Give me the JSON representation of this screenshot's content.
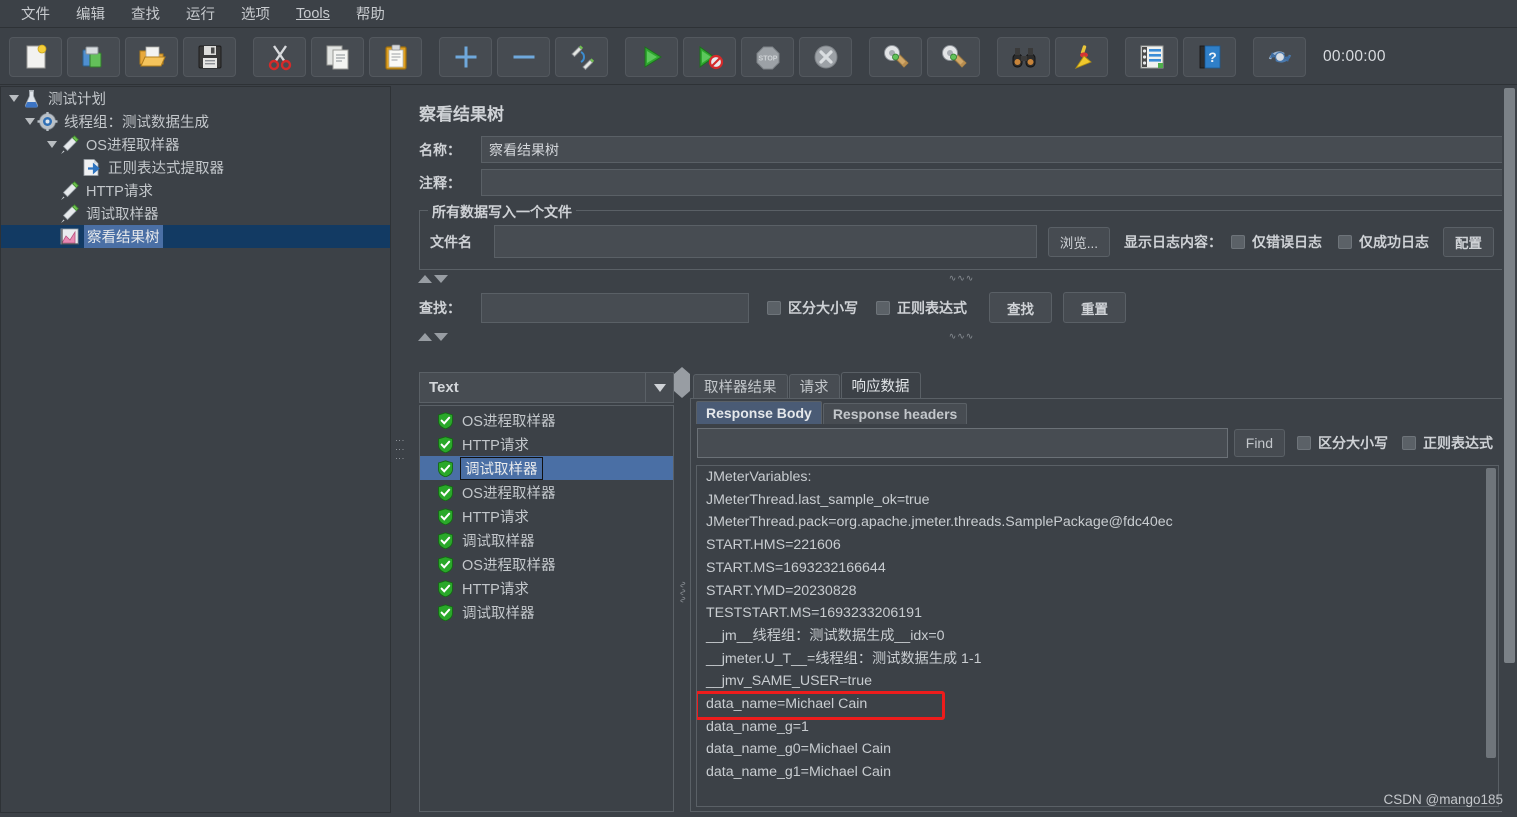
{
  "menubar": {
    "items": [
      {
        "label": "文件",
        "name": "menu-file"
      },
      {
        "label": "编辑",
        "name": "menu-edit"
      },
      {
        "label": "查找",
        "name": "menu-search"
      },
      {
        "label": "运行",
        "name": "menu-run"
      },
      {
        "label": "选项",
        "name": "menu-options"
      },
      {
        "label": "Tools",
        "name": "menu-tools",
        "mnemonic": "T"
      },
      {
        "label": "帮助",
        "name": "menu-help"
      }
    ]
  },
  "toolbar": {
    "buttons": [
      {
        "icon": "new-file-icon"
      },
      {
        "icon": "templates-icon"
      },
      {
        "icon": "open-folder-icon"
      },
      {
        "icon": "save-icon"
      },
      {
        "icon": "cut-icon"
      },
      {
        "icon": "copy-icon"
      },
      {
        "icon": "paste-icon"
      },
      {
        "icon": "expand-all-icon"
      },
      {
        "icon": "collapse-all-icon"
      },
      {
        "icon": "toggle-icon"
      },
      {
        "icon": "start-icon"
      },
      {
        "icon": "start-no-pauses-icon"
      },
      {
        "icon": "stop-icon"
      },
      {
        "icon": "shutdown-icon"
      },
      {
        "icon": "clear-icon"
      },
      {
        "icon": "clear-all-icon"
      },
      {
        "icon": "search-binoculars-icon"
      },
      {
        "icon": "search-reset-broom-icon"
      },
      {
        "icon": "function-helper-icon"
      },
      {
        "icon": "help-book-icon"
      },
      {
        "icon": "undo-redo-icon"
      }
    ],
    "timer": "00:00:00"
  },
  "tree": {
    "nodes": [
      {
        "label": "测试计划",
        "depth": 0,
        "icon": "test-plan-icon",
        "twisty": true,
        "selected": false
      },
      {
        "label": "线程组：测试数据生成",
        "depth": 1,
        "icon": "thread-group-icon",
        "twisty": true,
        "selected": false
      },
      {
        "label": "OS进程取样器",
        "depth": 2,
        "icon": "sampler-icon",
        "twisty": true,
        "selected": false
      },
      {
        "label": "正则表达式提取器",
        "depth": 3,
        "icon": "post-processor-icon",
        "twisty": false,
        "selected": false
      },
      {
        "label": "HTTP请求",
        "depth": 2,
        "icon": "sampler-icon",
        "twisty": false,
        "selected": false
      },
      {
        "label": "调试取样器",
        "depth": 2,
        "icon": "sampler-icon",
        "twisty": false,
        "selected": false
      },
      {
        "label": "察看结果树",
        "depth": 2,
        "icon": "view-results-tree-icon",
        "twisty": false,
        "selected": true
      }
    ]
  },
  "panel": {
    "title": "察看结果树",
    "name_label": "名称：",
    "name_value": "察看结果树",
    "comment_label": "注释：",
    "comment_value": "",
    "filegroup": {
      "legend": "所有数据写入一个文件",
      "filename_label": "文件名",
      "filename_value": "",
      "browse_button": "浏览...",
      "log_display_label": "显示日志内容：",
      "errors_only_label": "仅错误日志",
      "errors_only_checked": false,
      "success_only_label": "仅成功日志",
      "success_only_checked": false,
      "configure_button": "配置"
    },
    "search": {
      "label": "查找：",
      "value": "",
      "case_label": "区分大小写",
      "case_checked": false,
      "regex_label": "正则表达式",
      "regex_checked": false,
      "search_button": "查找",
      "reset_button": "重置"
    }
  },
  "results": {
    "renderer_selected": "Text",
    "items": [
      {
        "label": "OS进程取样器",
        "status": "success",
        "selected": false
      },
      {
        "label": "HTTP请求",
        "status": "success",
        "selected": false
      },
      {
        "label": "调试取样器",
        "status": "success",
        "selected": true
      },
      {
        "label": "OS进程取样器",
        "status": "success",
        "selected": false
      },
      {
        "label": "HTTP请求",
        "status": "success",
        "selected": false
      },
      {
        "label": "调试取样器",
        "status": "success",
        "selected": false
      },
      {
        "label": "OS进程取样器",
        "status": "success",
        "selected": false
      },
      {
        "label": "HTTP请求",
        "status": "success",
        "selected": false
      },
      {
        "label": "调试取样器",
        "status": "success",
        "selected": false
      }
    ]
  },
  "detail": {
    "tabs": [
      {
        "label": "取样器结果",
        "active": false
      },
      {
        "label": "请求",
        "active": false
      },
      {
        "label": "响应数据",
        "active": true
      }
    ],
    "subtabs": [
      {
        "label": "Response Body",
        "active": true
      },
      {
        "label": "Response headers",
        "active": false
      }
    ],
    "find": {
      "value": "",
      "find_button": "Find",
      "case_label": "区分大小写",
      "case_checked": false,
      "regex_label": "正则表达式",
      "regex_checked": false
    },
    "body_lines": [
      "JMeterVariables:",
      "JMeterThread.last_sample_ok=true",
      "JMeterThread.pack=org.apache.jmeter.threads.SamplePackage@fdc40ec",
      "START.HMS=221606",
      "START.MS=1693232166644",
      "START.YMD=20230828",
      "TESTSTART.MS=1693233206191",
      "__jm__线程组：测试数据生成__idx=0",
      "__jmeter.U_T__=线程组：测试数据生成 1-1",
      "__jmv_SAME_USER=true",
      "data_name=Michael Cain",
      "data_name_g=1",
      "data_name_g0=Michael Cain",
      "data_name_g1=Michael Cain"
    ],
    "highlight_line_index": 10,
    "highlight_color": "#ee1c1c"
  },
  "watermark": "CSDN @mango185"
}
